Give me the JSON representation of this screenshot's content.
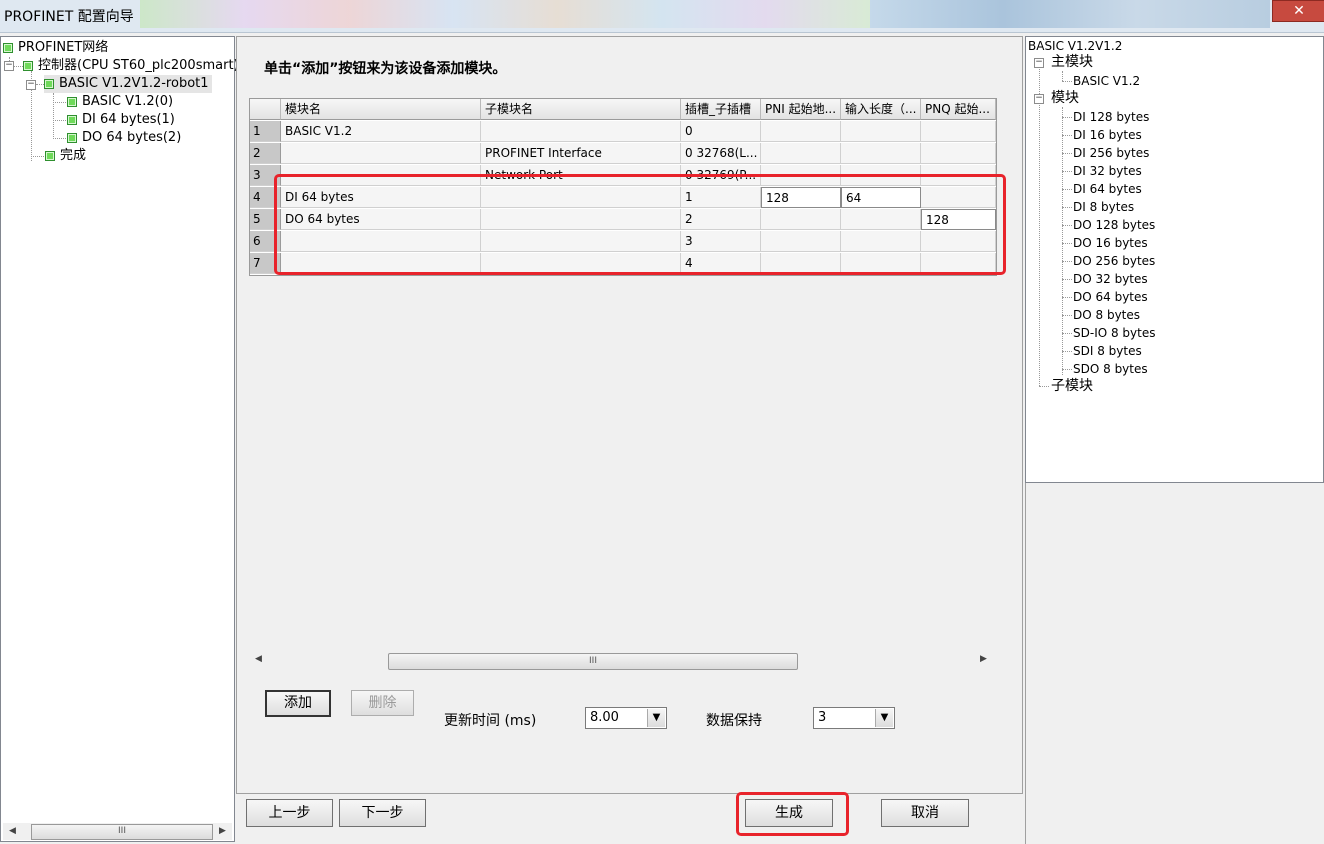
{
  "window": {
    "title": "PROFINET 配置向导",
    "close_glyph": "✕"
  },
  "left_tree": {
    "root": "PROFINET网络",
    "controller": "控制器(CPU ST60_plc200smart)",
    "device": "BASIC V1.2V1.2-robot1",
    "modules": [
      "BASIC V1.2(0)",
      "DI 64 bytes(1)",
      "DO 64 bytes(2)"
    ],
    "finish": "完成",
    "scroll_grip": "III"
  },
  "main": {
    "instruction": "单击“添加”按钮来为该设备添加模块。",
    "grid": {
      "columns": [
        "模块名",
        "子模块名",
        "插槽_子插槽",
        "PNI 起始地...",
        "输入长度（...",
        "PNQ 起始..."
      ],
      "rows": [
        {
          "n": "1",
          "module": "BASIC V1.2",
          "sub": "",
          "slot": "0",
          "pni": "",
          "inlen": "",
          "pnq": ""
        },
        {
          "n": "2",
          "module": "",
          "sub": "PROFINET Interface",
          "slot": "0 32768(L...",
          "pni": "",
          "inlen": "",
          "pnq": ""
        },
        {
          "n": "3",
          "module": "",
          "sub": "Network Port",
          "slot": "0 32769(P...",
          "pni": "",
          "inlen": "",
          "pnq": ""
        },
        {
          "n": "4",
          "module": "DI 64 bytes",
          "sub": "",
          "slot": "1",
          "pni": "128",
          "inlen": "64",
          "pnq": ""
        },
        {
          "n": "5",
          "module": "DO 64 bytes",
          "sub": "",
          "slot": "2",
          "pni": "",
          "inlen": "",
          "pnq": "128"
        },
        {
          "n": "6",
          "module": "",
          "sub": "",
          "slot": "3",
          "pni": "",
          "inlen": "",
          "pnq": ""
        },
        {
          "n": "7",
          "module": "",
          "sub": "",
          "slot": "4",
          "pni": "",
          "inlen": "",
          "pnq": ""
        }
      ]
    },
    "scroll_grip": "III",
    "add_button": "添加",
    "delete_button": "删除",
    "update_time_label": "更新时间 (ms)",
    "update_time_value": "8.00",
    "data_hold_label": "数据保持",
    "data_hold_value": "3"
  },
  "right_tree": {
    "title": "BASIC V1.2V1.2",
    "main_module_group": "主模块",
    "main_module": "BASIC V1.2",
    "module_group": "模块",
    "modules": [
      "DI 128 bytes",
      "DI 16 bytes",
      "DI 256 bytes",
      "DI 32 bytes",
      "DI 64 bytes",
      "DI 8 bytes",
      "DO 128 bytes",
      "DO 16 bytes",
      "DO 256 bytes",
      "DO 32 bytes",
      "DO 64 bytes",
      "DO 8 bytes",
      "SD-IO 8 bytes",
      "SDI 8 bytes",
      "SDO 8 bytes"
    ],
    "submodule_group": "子模块"
  },
  "bottom": {
    "prev": "上一步",
    "next": "下一步",
    "generate": "生成",
    "cancel": "取消"
  },
  "colors": {
    "highlight_red": "#e8232b",
    "tree_node_green": "#6fda5a"
  }
}
